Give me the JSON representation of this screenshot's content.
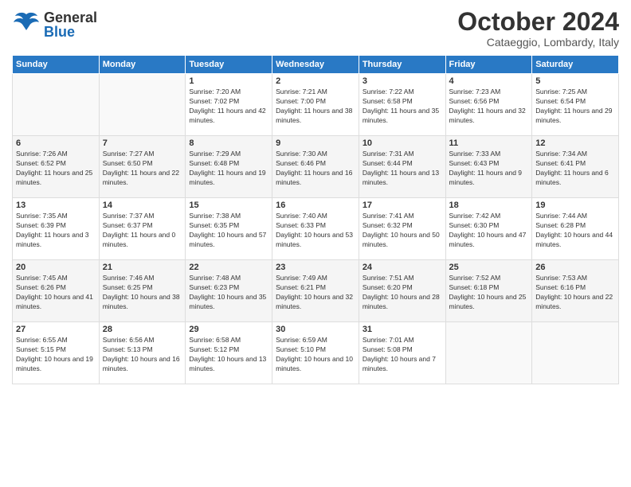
{
  "header": {
    "logo_general": "General",
    "logo_blue": "Blue",
    "month": "October 2024",
    "location": "Cataeggio, Lombardy, Italy"
  },
  "weekdays": [
    "Sunday",
    "Monday",
    "Tuesday",
    "Wednesday",
    "Thursday",
    "Friday",
    "Saturday"
  ],
  "weeks": [
    [
      {
        "day": "",
        "info": ""
      },
      {
        "day": "",
        "info": ""
      },
      {
        "day": "1",
        "info": "Sunrise: 7:20 AM\nSunset: 7:02 PM\nDaylight: 11 hours and 42 minutes."
      },
      {
        "day": "2",
        "info": "Sunrise: 7:21 AM\nSunset: 7:00 PM\nDaylight: 11 hours and 38 minutes."
      },
      {
        "day": "3",
        "info": "Sunrise: 7:22 AM\nSunset: 6:58 PM\nDaylight: 11 hours and 35 minutes."
      },
      {
        "day": "4",
        "info": "Sunrise: 7:23 AM\nSunset: 6:56 PM\nDaylight: 11 hours and 32 minutes."
      },
      {
        "day": "5",
        "info": "Sunrise: 7:25 AM\nSunset: 6:54 PM\nDaylight: 11 hours and 29 minutes."
      }
    ],
    [
      {
        "day": "6",
        "info": "Sunrise: 7:26 AM\nSunset: 6:52 PM\nDaylight: 11 hours and 25 minutes."
      },
      {
        "day": "7",
        "info": "Sunrise: 7:27 AM\nSunset: 6:50 PM\nDaylight: 11 hours and 22 minutes."
      },
      {
        "day": "8",
        "info": "Sunrise: 7:29 AM\nSunset: 6:48 PM\nDaylight: 11 hours and 19 minutes."
      },
      {
        "day": "9",
        "info": "Sunrise: 7:30 AM\nSunset: 6:46 PM\nDaylight: 11 hours and 16 minutes."
      },
      {
        "day": "10",
        "info": "Sunrise: 7:31 AM\nSunset: 6:44 PM\nDaylight: 11 hours and 13 minutes."
      },
      {
        "day": "11",
        "info": "Sunrise: 7:33 AM\nSunset: 6:43 PM\nDaylight: 11 hours and 9 minutes."
      },
      {
        "day": "12",
        "info": "Sunrise: 7:34 AM\nSunset: 6:41 PM\nDaylight: 11 hours and 6 minutes."
      }
    ],
    [
      {
        "day": "13",
        "info": "Sunrise: 7:35 AM\nSunset: 6:39 PM\nDaylight: 11 hours and 3 minutes."
      },
      {
        "day": "14",
        "info": "Sunrise: 7:37 AM\nSunset: 6:37 PM\nDaylight: 11 hours and 0 minutes."
      },
      {
        "day": "15",
        "info": "Sunrise: 7:38 AM\nSunset: 6:35 PM\nDaylight: 10 hours and 57 minutes."
      },
      {
        "day": "16",
        "info": "Sunrise: 7:40 AM\nSunset: 6:33 PM\nDaylight: 10 hours and 53 minutes."
      },
      {
        "day": "17",
        "info": "Sunrise: 7:41 AM\nSunset: 6:32 PM\nDaylight: 10 hours and 50 minutes."
      },
      {
        "day": "18",
        "info": "Sunrise: 7:42 AM\nSunset: 6:30 PM\nDaylight: 10 hours and 47 minutes."
      },
      {
        "day": "19",
        "info": "Sunrise: 7:44 AM\nSunset: 6:28 PM\nDaylight: 10 hours and 44 minutes."
      }
    ],
    [
      {
        "day": "20",
        "info": "Sunrise: 7:45 AM\nSunset: 6:26 PM\nDaylight: 10 hours and 41 minutes."
      },
      {
        "day": "21",
        "info": "Sunrise: 7:46 AM\nSunset: 6:25 PM\nDaylight: 10 hours and 38 minutes."
      },
      {
        "day": "22",
        "info": "Sunrise: 7:48 AM\nSunset: 6:23 PM\nDaylight: 10 hours and 35 minutes."
      },
      {
        "day": "23",
        "info": "Sunrise: 7:49 AM\nSunset: 6:21 PM\nDaylight: 10 hours and 32 minutes."
      },
      {
        "day": "24",
        "info": "Sunrise: 7:51 AM\nSunset: 6:20 PM\nDaylight: 10 hours and 28 minutes."
      },
      {
        "day": "25",
        "info": "Sunrise: 7:52 AM\nSunset: 6:18 PM\nDaylight: 10 hours and 25 minutes."
      },
      {
        "day": "26",
        "info": "Sunrise: 7:53 AM\nSunset: 6:16 PM\nDaylight: 10 hours and 22 minutes."
      }
    ],
    [
      {
        "day": "27",
        "info": "Sunrise: 6:55 AM\nSunset: 5:15 PM\nDaylight: 10 hours and 19 minutes."
      },
      {
        "day": "28",
        "info": "Sunrise: 6:56 AM\nSunset: 5:13 PM\nDaylight: 10 hours and 16 minutes."
      },
      {
        "day": "29",
        "info": "Sunrise: 6:58 AM\nSunset: 5:12 PM\nDaylight: 10 hours and 13 minutes."
      },
      {
        "day": "30",
        "info": "Sunrise: 6:59 AM\nSunset: 5:10 PM\nDaylight: 10 hours and 10 minutes."
      },
      {
        "day": "31",
        "info": "Sunrise: 7:01 AM\nSunset: 5:08 PM\nDaylight: 10 hours and 7 minutes."
      },
      {
        "day": "",
        "info": ""
      },
      {
        "day": "",
        "info": ""
      }
    ]
  ]
}
